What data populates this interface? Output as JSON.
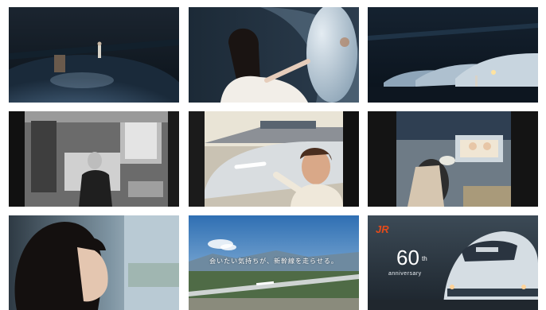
{
  "tiles": [
    {
      "id": "hall-dark"
    },
    {
      "id": "woman-touching-nose"
    },
    {
      "id": "trains-lineup"
    },
    {
      "id": "bw-cabin"
    },
    {
      "id": "child-and-train"
    },
    {
      "id": "platform-family"
    },
    {
      "id": "woman-window"
    },
    {
      "id": "landscape-bridge"
    },
    {
      "id": "anniversary-poster"
    }
  ],
  "landscape": {
    "caption": "会いたい気持ちが、新幹線を走らせる。"
  },
  "poster": {
    "logo": "JR",
    "number": "60",
    "suffix": "th",
    "word": "anniversary"
  }
}
